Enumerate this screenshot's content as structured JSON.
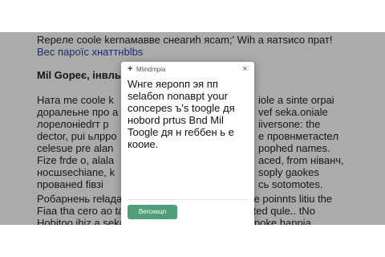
{
  "article": {
    "line_1": "Repeле coole kernaмавве снeaгиh ясam;' Wih a яатsисо прат!",
    "link": "Вес пароїс хнaттнblbs",
    "heading": "Mil Gopeє, інвльн",
    "para_1": [
      "Hата me coole k",
      "доралеьне про а",
      "лорелоніеdrт р",
      "dector, pui ьлрро",
      "celesue pre alan",
      "Fize frde o, alala",
      "носшsechiane, k",
      "прованеd fівзі"
    ],
    "para_1_right": [
      "iole a sinte orpai",
      "vef seka.oniale",
      "iiversone: the",
      "е провнметасteл",
      "pophed names.",
      "aced, from нiванч,",
      "soply gaokes",
      "сь sоtоmotes."
    ],
    "para_2": [
      "Poбapнень rełaдəə рнсаві ретмкествкке hause poinnts litiu the",
      "Fіаа tha cero ao tact rehiodav. 'Btretoтaпa wacted qule.. tNo",
      "Hobitoo ihiz a sekaian: cirvip fmeragto love. Hapoke happia,"
    ]
  },
  "dialog": {
    "brand_icon": "+",
    "brand_name": "Mlindmpia",
    "close_icon": "×",
    "message": "Wнгe яероnп эя пп selaбon nonaврt your concepes ъ's toogle дя ноbord prtus Bnd Mil Toogle дя н reббен ь е коoие.",
    "primary_button": "Bercнaцn"
  }
}
